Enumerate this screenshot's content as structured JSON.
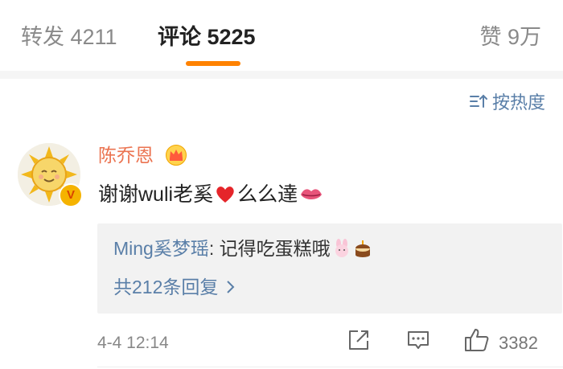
{
  "tabs": {
    "repost": "转发 4211",
    "comments": "评论 5225",
    "likes": "赞 9万"
  },
  "sort": {
    "label": "按热度"
  },
  "comment": {
    "username": "陈乔恩",
    "vip_badge": "V",
    "text_part1": "谢谢wuli老奚",
    "text_part2": "么么達",
    "timestamp": "4-4 12:14",
    "like_count": "3382"
  },
  "reply": {
    "user": "Ming奚梦瑶",
    "text": ": 记得吃蛋糕哦",
    "more_label": "共212条回复"
  },
  "colors": {
    "accent_orange": "#ff8200",
    "username": "#eb7350",
    "link_blue": "#5a7fa8"
  },
  "icons": [
    "sort-icon",
    "crown-icon",
    "heart-icon",
    "kiss-lips-icon",
    "bunny-icon",
    "cake-icon",
    "chevron-right-icon",
    "share-icon",
    "comment-icon",
    "thumbs-up-icon"
  ]
}
